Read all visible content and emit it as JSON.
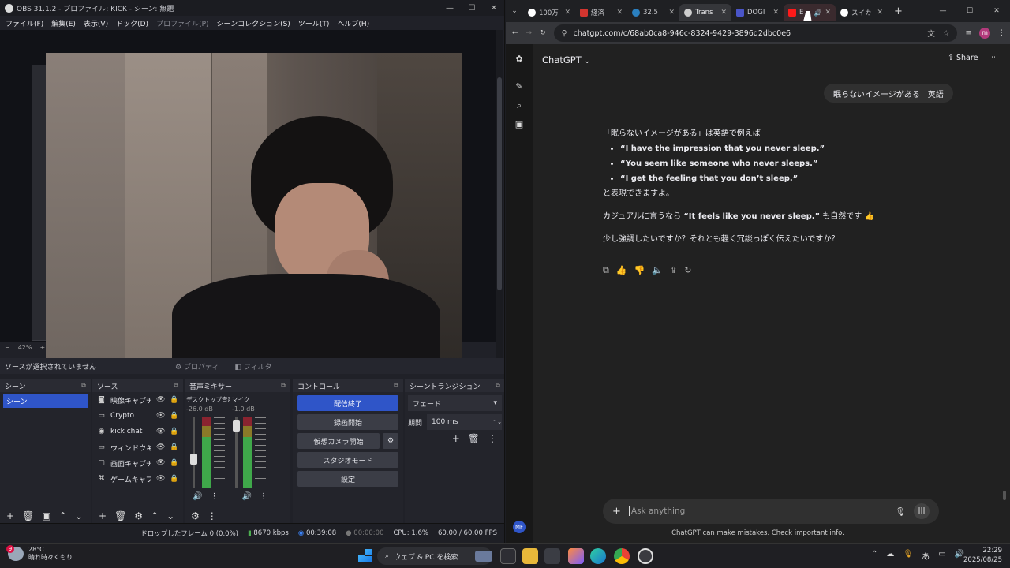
{
  "obs": {
    "title": "OBS 31.1.2 - プロファイル: KICK - シーン: 無題",
    "menu": [
      "ファイル(F)",
      "編集(E)",
      "表示(V)",
      "ドック(D)",
      "プロファイル(P)",
      "シーンコレクション(S)",
      "ツール(T)",
      "ヘルプ(H)"
    ],
    "zoom": "42%",
    "no_source_selected": "ソースが選択されていません",
    "properties": "プロパティ",
    "filters": "フィルタ",
    "docks": {
      "scenes": {
        "title": "シーン",
        "items": [
          "シーン"
        ]
      },
      "sources": {
        "title": "ソース",
        "items": [
          "映像キャプチャ",
          "Crypto",
          "kick chat",
          "ウィンドウキャプ",
          "画面キャプチャ",
          "ゲームキャプチャ"
        ]
      },
      "mixer": {
        "title": "音声ミキサー",
        "channels": [
          {
            "name": "デスクトップ音声",
            "db": "-26.0 dB"
          },
          {
            "name": "マイク",
            "db": "-1.0 dB"
          }
        ]
      },
      "controls": {
        "title": "コントロール",
        "buttons": [
          "配信終了",
          "録画開始",
          "仮想カメラ開始",
          "スタジオモード",
          "設定"
        ]
      },
      "transitions": {
        "title": "シーントランジション",
        "selected": "フェード",
        "duration_label": "期間",
        "duration": "100 ms"
      }
    },
    "status": {
      "dropped": "ドロップしたフレーム 0 (0.0%)",
      "bitrate": "8670 kbps",
      "live_time": "00:39:08",
      "rec_time": "00:00:00",
      "cpu": "CPU: 1.6%",
      "fps": "60.00 / 60.00 FPS"
    }
  },
  "chrome": {
    "tabs": [
      "100万",
      "経済",
      "32.5",
      "Trans",
      "DOGI",
      "E",
      "スイカ"
    ],
    "url": "chatgpt.com/c/68ab0ca8-946c-8324-9429-3896d2dbc0e6",
    "app_name": "ChatGPT",
    "share": "Share",
    "user_message": "眠らないイメージがある　英語",
    "answer": {
      "intro": "「眠らないイメージがある」は英語で例えば",
      "bullets": [
        "“I have the impression that you never sleep.”",
        "“You seem like someone who never sleeps.”",
        "“I get the feeling that you don’t sleep.”"
      ],
      "after": "と表現できますよ。",
      "casual_prefix": "カジュアルに言うなら ",
      "casual_bold": "“It feels like you never sleep.”",
      "casual_suffix": " も自然です 👍",
      "question": "少し強調したいですか？それとも軽く冗談っぽく伝えたいですか？"
    },
    "composer_placeholder": "Ask anything",
    "disclaimer": "ChatGPT can make mistakes. Check important info.",
    "avatar": "MF",
    "profile": "m"
  },
  "taskbar": {
    "weather_temp": "28°C",
    "weather_text": "晴れ時々くもり",
    "badge": "9",
    "search": "ウェブ & PC を検索",
    "time": "22:29",
    "date": "2025/08/25"
  }
}
